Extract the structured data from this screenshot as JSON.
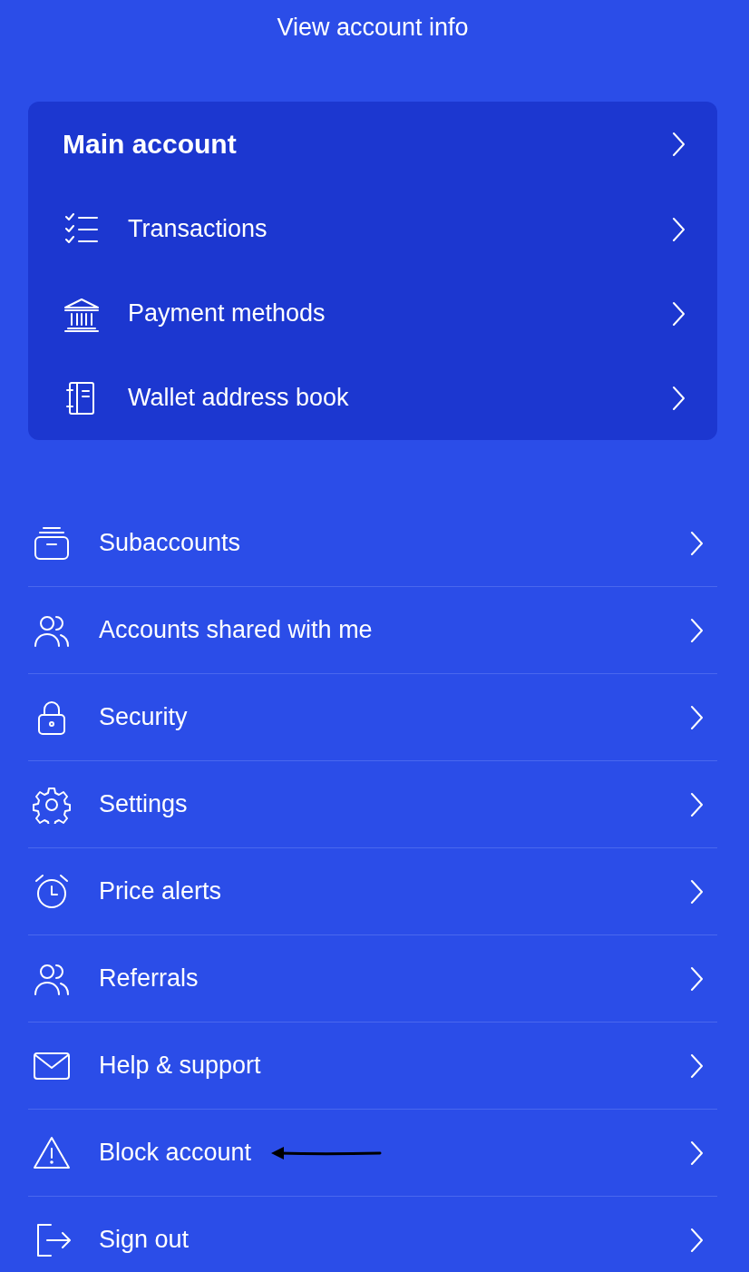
{
  "header": {
    "link": "View account info"
  },
  "main_account": {
    "title": "Main account",
    "items": [
      {
        "label": "Transactions"
      },
      {
        "label": "Payment methods"
      },
      {
        "label": "Wallet address book"
      }
    ]
  },
  "menu": [
    {
      "label": "Subaccounts",
      "marked": false
    },
    {
      "label": "Accounts shared with me",
      "marked": false
    },
    {
      "label": "Security",
      "marked": false
    },
    {
      "label": "Settings",
      "marked": false
    },
    {
      "label": "Price alerts",
      "marked": false
    },
    {
      "label": "Referrals",
      "marked": false
    },
    {
      "label": "Help & support",
      "marked": false
    },
    {
      "label": "Block account",
      "marked": true
    },
    {
      "label": "Sign out",
      "marked": false
    }
  ]
}
